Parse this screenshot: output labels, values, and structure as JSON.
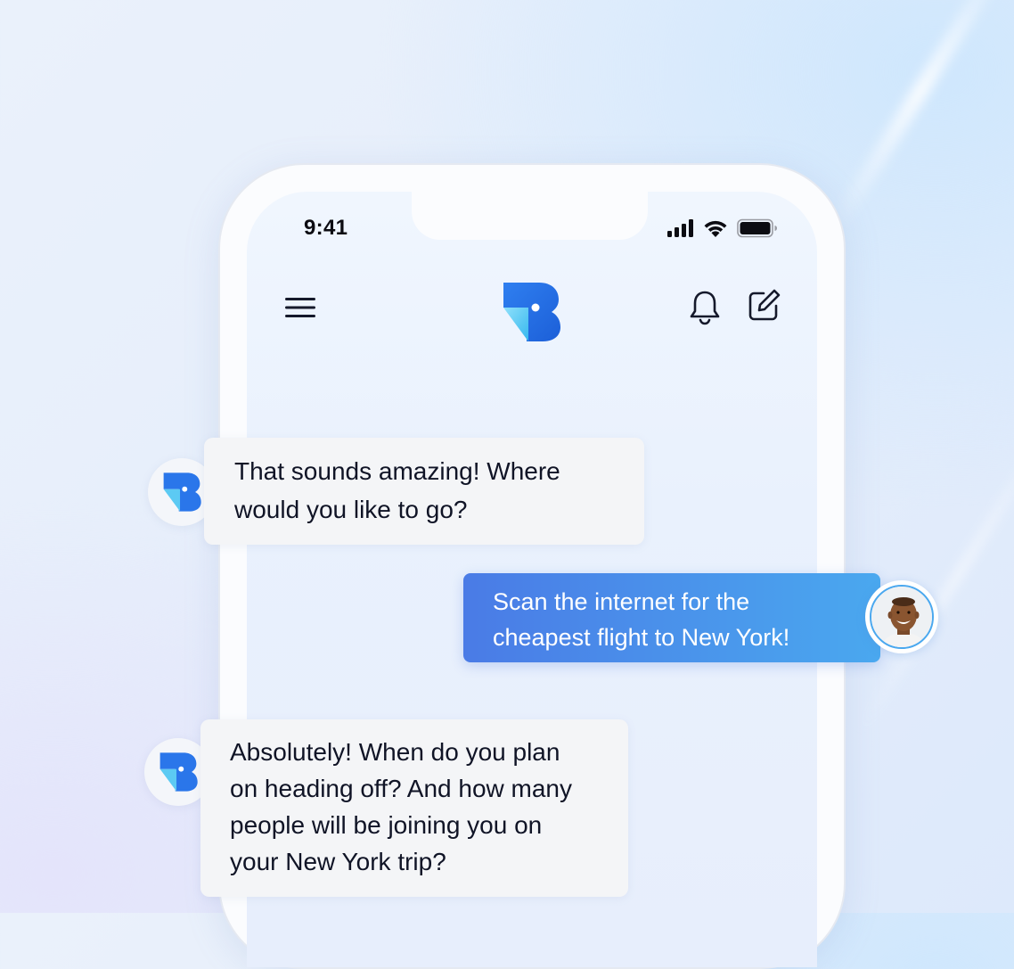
{
  "status_bar": {
    "time": "9:41"
  },
  "header": {
    "menu_icon": "hamburger-menu-icon",
    "logo_icon": "brand-b-logo",
    "bell_icon": "bell-icon",
    "compose_icon": "compose-icon"
  },
  "messages": [
    {
      "sender": "bot",
      "lines": [
        "That sounds amazing! Where",
        "would you like to go?"
      ]
    },
    {
      "sender": "user",
      "lines": [
        "Scan the internet for the",
        "cheapest flight to New York!"
      ]
    },
    {
      "sender": "bot",
      "lines": [
        "Absolutely! When do you plan",
        "on heading off? And how many",
        "people will be joining you on",
        "your New York trip?"
      ]
    }
  ],
  "colors": {
    "accent_gradient_start": "#4a7be6",
    "accent_gradient_end": "#4aa8ef",
    "logo_dark_blue": "#1f66e0",
    "logo_cyan": "#3ec3f0",
    "text_primary": "#101426"
  }
}
